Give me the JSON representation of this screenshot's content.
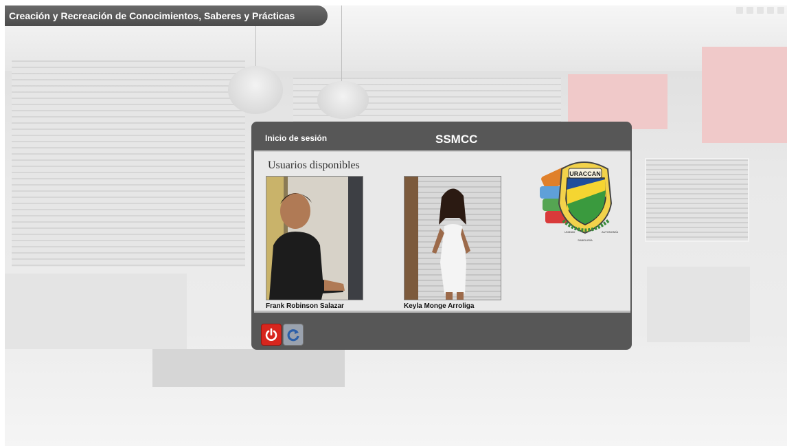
{
  "app": {
    "title": "Creación y Recreación de Conocimientos, Saberes y Prácticas"
  },
  "login": {
    "title": "Inicio de sesión",
    "app_name": "SSMCC",
    "users_heading": "Usuarios disponibles",
    "users": [
      {
        "name": "Frank Robinson Salazar"
      },
      {
        "name": "Keyla Monge Arroliga"
      }
    ],
    "logo": {
      "text": "URACCAN",
      "motto_left": "UNIDAD",
      "motto_center": "SABIDURÍA",
      "motto_right": "AUTONOMÍA"
    }
  },
  "buttons": {
    "power_icon": "power-icon",
    "refresh_icon": "refresh-icon"
  },
  "colors": {
    "titlebar": "#4b4b4b",
    "window": "#575757",
    "panel": "#e9e9e9",
    "power_button": "#d7261e"
  }
}
